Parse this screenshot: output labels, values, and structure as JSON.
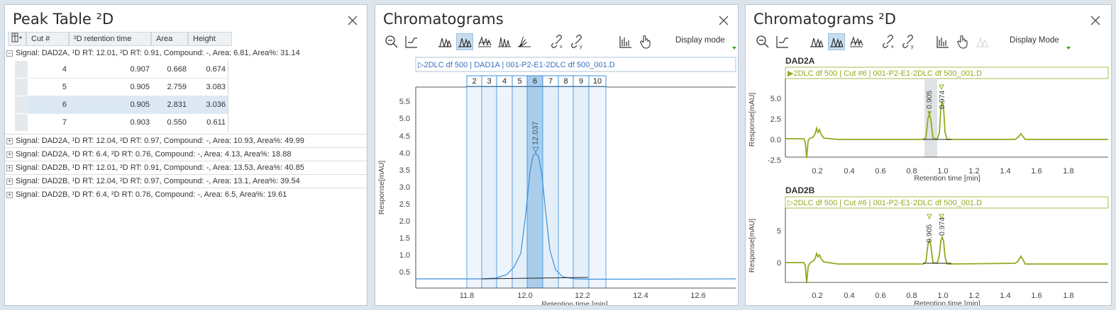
{
  "peak_table": {
    "title": "Peak Table ²D",
    "columns": [
      "Cut #",
      "²D retention time",
      "Area",
      "Height"
    ],
    "signals": [
      {
        "label": "Signal: DAD2A, ¹D RT: 12.01, ²D RT: 0.91, Compound: -, Area: 6.81, Area%: 31.14",
        "expander": "⊟"
      },
      {
        "label": "Signal: DAD2A, ¹D RT: 12.04, ²D RT: 0.97, Compound: -, Area: 10.93, Area%: 49.99",
        "expander": "⊞"
      },
      {
        "label": "Signal: DAD2A, ¹D RT: 6.4, ²D RT: 0.76, Compound: -, Area: 4.13, Area%: 18.88",
        "expander": "⊞"
      },
      {
        "label": "Signal: DAD2B, ¹D RT: 12.01, ²D RT: 0.91, Compound: -, Area: 13.53, Area%: 40.85",
        "expander": "⊞"
      },
      {
        "label": "Signal: DAD2B, ¹D RT: 12.04, ²D RT: 0.97, Compound: -, Area: 13.1, Area%: 39.54",
        "expander": "⊞"
      },
      {
        "label": "Signal: DAD2B, ¹D RT: 6.4, ²D RT: 0.76, Compound: -, Area: 6.5, Area%: 19.61",
        "expander": "⊞"
      }
    ],
    "rows": [
      {
        "cut": "4",
        "rt": "0.907",
        "area": "0.668",
        "height": "0.674"
      },
      {
        "cut": "5",
        "rt": "0.905",
        "area": "2.759",
        "height": "3.083"
      },
      {
        "cut": "6",
        "rt": "0.905",
        "area": "2.831",
        "height": "3.036"
      },
      {
        "cut": "7",
        "rt": "0.903",
        "area": "0.550",
        "height": "0.611"
      }
    ],
    "selected_row": 2
  },
  "chromatograms": {
    "title": "Chromatograms",
    "display_mode": "Display mode",
    "trace_label": "▷2DLC df 500 | DAD1A | 001-P2-E1-2DLC df 500_001.D",
    "cuts": [
      "2",
      "3",
      "4",
      "5",
      "6",
      "7",
      "8",
      "9",
      "10"
    ],
    "selected_cut": "6",
    "peak_label": "12.037",
    "ylabel": "Response[mAU]",
    "xlabel": "Retention time [min]",
    "xticks": [
      "11.8",
      "12.0",
      "12.2",
      "12.4",
      "12.6"
    ],
    "yticks": [
      "0.5",
      "1.0",
      "1.5",
      "2.0",
      "2.5",
      "3.0",
      "3.5",
      "4.0",
      "4.5",
      "5.0",
      "5.5"
    ]
  },
  "chromatograms_2d": {
    "title": "Chromatograms ²D",
    "display_mode": "Display Mode",
    "panels": [
      {
        "name": "DAD2A",
        "trace": "▶2DLC df 500 | Cut #6 | 001-P2-E1-2DLC df 500_001.D",
        "yticks": [
          "5.0",
          "2.5",
          "0.0",
          "-2.5"
        ],
        "peaks": [
          "0.905",
          "0.974"
        ]
      },
      {
        "name": "DAD2B",
        "trace": "▷2DLC df 500 | Cut #6 | 001-P2-E1-2DLC df 500_001.D",
        "yticks": [
          "5",
          "0"
        ],
        "peaks": [
          "0.905",
          "0.974"
        ]
      }
    ],
    "ylabel": "Response[mAU]",
    "xlabel": "Retention time [min]",
    "xticks": [
      "0.2",
      "0.4",
      "0.6",
      "0.8",
      "1.0",
      "1.2",
      "1.4",
      "1.6",
      "1.8"
    ]
  },
  "colors": {
    "accent": "#3b8fd9",
    "trace_green": "#8fac1e",
    "selection": "#dce9f5"
  }
}
